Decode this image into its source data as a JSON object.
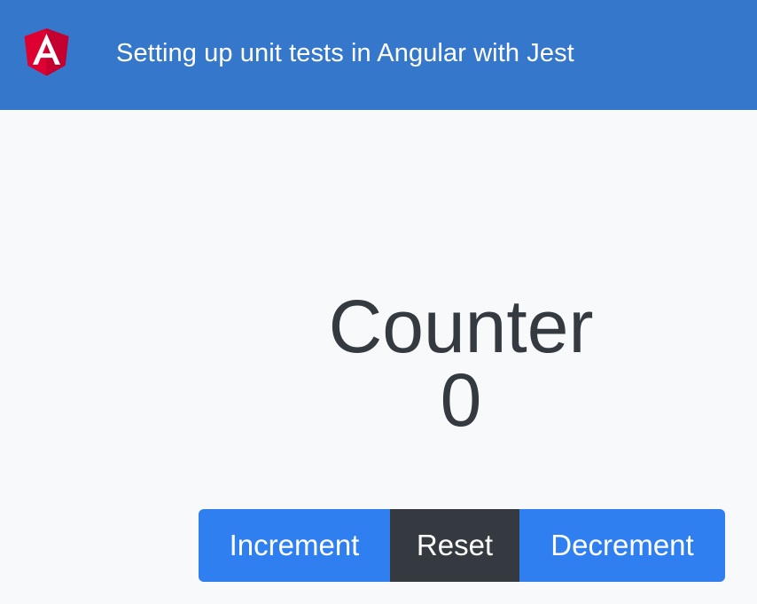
{
  "header": {
    "logo_icon": "angular-logo-icon",
    "logo_letter": "A",
    "title": "Setting up unit tests in Angular with Jest",
    "background": "#3577cb"
  },
  "main": {
    "heading": "Counter",
    "count": "0"
  },
  "actions": {
    "increment_label": "Increment",
    "reset_label": "Reset",
    "decrement_label": "Decrement"
  },
  "colors": {
    "primary": "#2f7ff0",
    "dark": "#343a40",
    "angular_red": "#dd0031",
    "angular_dark_red": "#c3002f"
  }
}
